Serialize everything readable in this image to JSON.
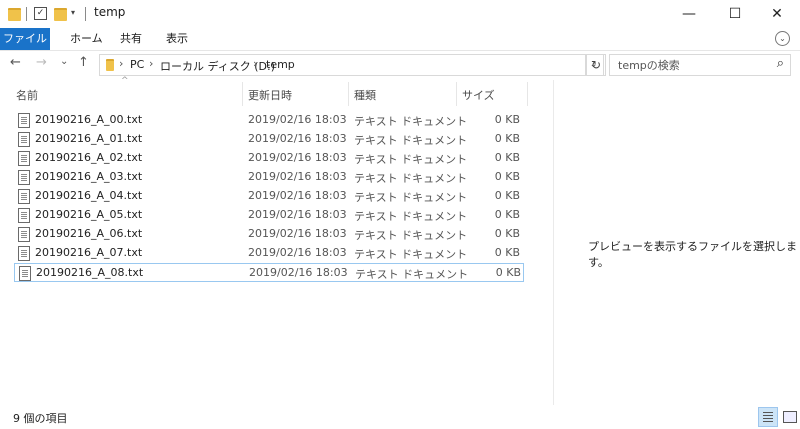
{
  "window": {
    "title": "temp",
    "minimize": "—",
    "maximize": "☐",
    "close": "✕"
  },
  "ribbon": {
    "tabs": [
      "ファイル",
      "ホーム",
      "共有",
      "表示"
    ],
    "expand": "⌄"
  },
  "nav": {
    "back": "←",
    "forward": "→",
    "recent": "⌄",
    "up": "↑"
  },
  "address": {
    "crumbs": [
      "PC",
      "ローカル ディスク (D:)",
      "temp"
    ],
    "dropdown": "⌄",
    "refresh": "↻"
  },
  "search": {
    "placeholder": "tempの検索",
    "icon": "⌕"
  },
  "columns": {
    "name": "名前",
    "date": "更新日時",
    "type": "種類",
    "size": "サイズ"
  },
  "files": [
    {
      "name": "20190216_A_00.txt",
      "date": "2019/02/16 18:03",
      "type": "テキスト ドキュメント",
      "size": "0 KB"
    },
    {
      "name": "20190216_A_01.txt",
      "date": "2019/02/16 18:03",
      "type": "テキスト ドキュメント",
      "size": "0 KB"
    },
    {
      "name": "20190216_A_02.txt",
      "date": "2019/02/16 18:03",
      "type": "テキスト ドキュメント",
      "size": "0 KB"
    },
    {
      "name": "20190216_A_03.txt",
      "date": "2019/02/16 18:03",
      "type": "テキスト ドキュメント",
      "size": "0 KB"
    },
    {
      "name": "20190216_A_04.txt",
      "date": "2019/02/16 18:03",
      "type": "テキスト ドキュメント",
      "size": "0 KB"
    },
    {
      "name": "20190216_A_05.txt",
      "date": "2019/02/16 18:03",
      "type": "テキスト ドキュメント",
      "size": "0 KB"
    },
    {
      "name": "20190216_A_06.txt",
      "date": "2019/02/16 18:03",
      "type": "テキスト ドキュメント",
      "size": "0 KB"
    },
    {
      "name": "20190216_A_07.txt",
      "date": "2019/02/16 18:03",
      "type": "テキスト ドキュメント",
      "size": "0 KB"
    },
    {
      "name": "20190216_A_08.txt",
      "date": "2019/02/16 18:03",
      "type": "テキスト ドキュメント",
      "size": "0 KB"
    }
  ],
  "preview": {
    "message": "プレビューを表示するファイルを選択します。"
  },
  "status": {
    "item_count": "9 個の項目"
  },
  "colors": {
    "file_tab": "#1a73c9",
    "selection_border": "#99c8f0"
  }
}
